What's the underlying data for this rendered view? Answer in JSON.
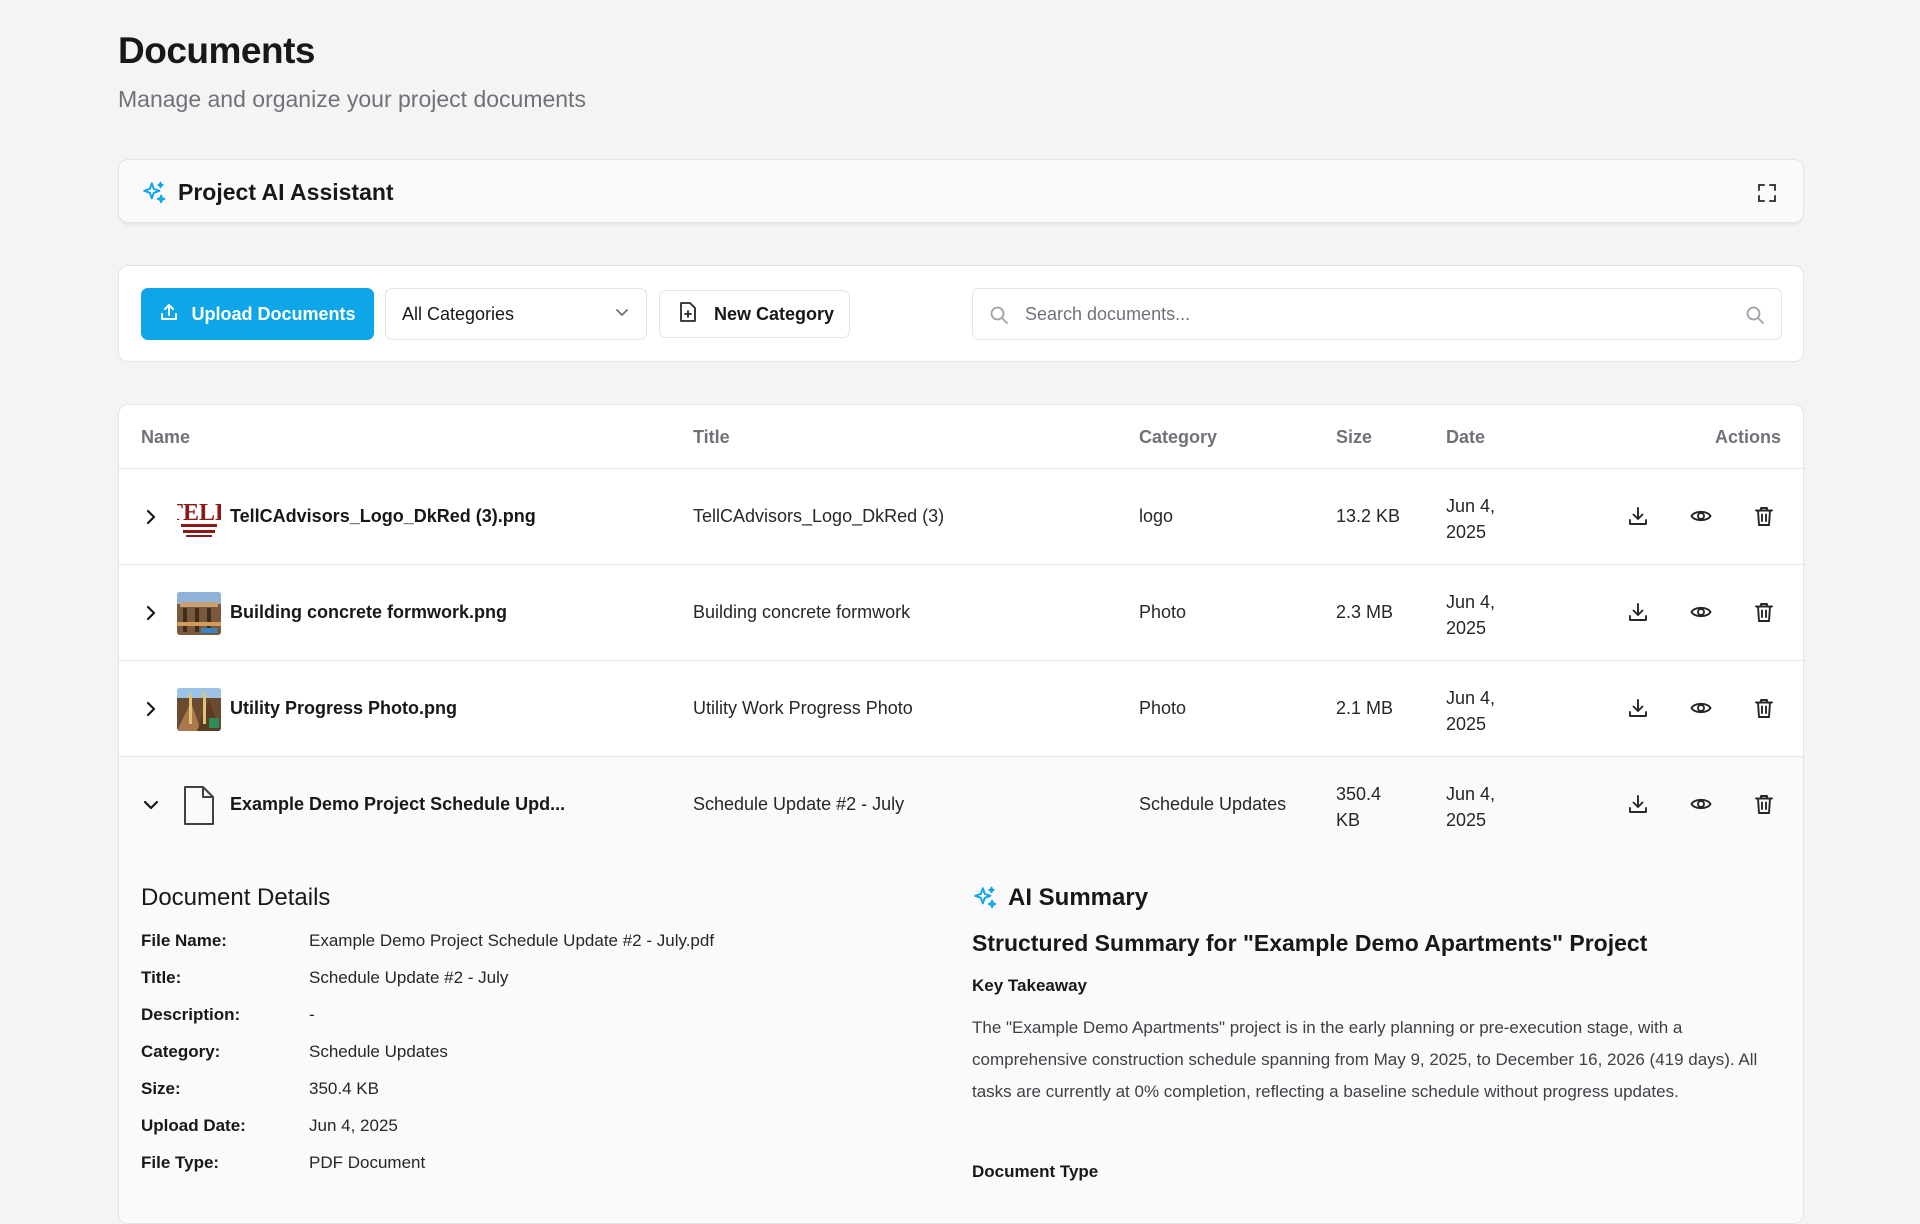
{
  "header": {
    "title": "Documents",
    "subtitle": "Manage and organize your project documents"
  },
  "ai_assistant": {
    "title": "Project AI Assistant"
  },
  "toolbar": {
    "upload_label": "Upload Documents",
    "category_selected": "All Categories",
    "new_category_label": "New Category",
    "search_placeholder": "Search documents..."
  },
  "table": {
    "columns": {
      "name": "Name",
      "title": "Title",
      "category": "Category",
      "size": "Size",
      "date": "Date",
      "actions": "Actions"
    },
    "rows": [
      {
        "name": "TellCAdvisors_Logo_DkRed (3).png",
        "title": "TellCAdvisors_Logo_DkRed (3)",
        "category": "logo",
        "size": "13.2 KB",
        "date_line1": "Jun 4,",
        "date_line2": "2025",
        "thumb": "logo-image",
        "thumb_text": "TELL"
      },
      {
        "name": "Building concrete formwork.png",
        "title": "Building concrete formwork",
        "category": "Photo",
        "size": "2.3 MB",
        "date_line1": "Jun 4,",
        "date_line2": "2025",
        "thumb": "photo-image"
      },
      {
        "name": "Utility Progress Photo.png",
        "title": "Utility Work Progress Photo",
        "category": "Photo",
        "size": "2.1 MB",
        "date_line1": "Jun 4,",
        "date_line2": "2025",
        "thumb": "photo-image"
      },
      {
        "name": "Example Demo Project Schedule Upd...",
        "title": "Schedule Update #2 - July",
        "category": "Schedule Updates",
        "size_line1": "350.4",
        "size_line2": "KB",
        "date_line1": "Jun 4,",
        "date_line2": "2025",
        "thumb": "file-icon",
        "expanded": true
      }
    ]
  },
  "details": {
    "title": "Document Details",
    "fields": [
      {
        "label": "File Name:",
        "value": "Example Demo Project Schedule Update #2 - July.pdf"
      },
      {
        "label": "Title:",
        "value": "Schedule Update #2 - July"
      },
      {
        "label": "Description:",
        "value": "-"
      },
      {
        "label": "Category:",
        "value": "Schedule Updates"
      },
      {
        "label": "Size:",
        "value": "350.4 KB"
      },
      {
        "label": "Upload Date:",
        "value": "Jun 4, 2025"
      },
      {
        "label": "File Type:",
        "value": "PDF Document"
      }
    ]
  },
  "summary": {
    "title": "AI Summary",
    "heading": "Structured Summary for \"Example Demo Apartments\" Project",
    "key_takeaway_label": "Key Takeaway",
    "key_takeaway_text": "The \"Example Demo Apartments\" project is in the early planning or pre-execution stage, with a comprehensive construction schedule spanning from May 9, 2025, to December 16, 2026 (419 days). All tasks are currently at 0% completion, reflecting a baseline schedule without progress updates.",
    "document_type_label": "Document Type"
  },
  "colors": {
    "accent": "#0ea5e9",
    "background": "#f4f4f5",
    "logo_red": "#8b1a1a"
  }
}
